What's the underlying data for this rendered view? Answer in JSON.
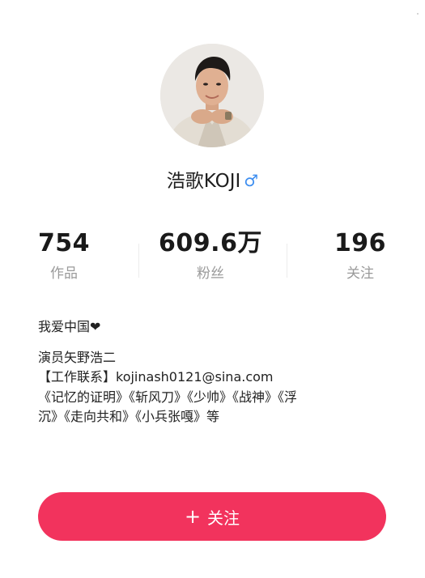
{
  "profile": {
    "name": "浩歌KOJI",
    "gender_symbol": "♂",
    "avatar_icon": "avatar-photo"
  },
  "stats": [
    {
      "value": "754",
      "label": "作品"
    },
    {
      "value": "609.6万",
      "label": "粉丝"
    },
    {
      "value": "196",
      "label": "关注"
    }
  ],
  "bio": {
    "lines": [
      "我爱中国❤",
      "",
      "演员矢野浩二",
      "【工作联系】kojinash0121@sina.com",
      "《记忆的证明》《斩风刀》《少帅》《战神》《浮",
      "沉》《走向共和》《小兵张嘎》等"
    ]
  },
  "follow_button": {
    "icon": "+",
    "label": "关注"
  },
  "colors": {
    "accent": "#f2335d",
    "gender": "#3d8ef0",
    "muted": "#9a9a9a"
  }
}
